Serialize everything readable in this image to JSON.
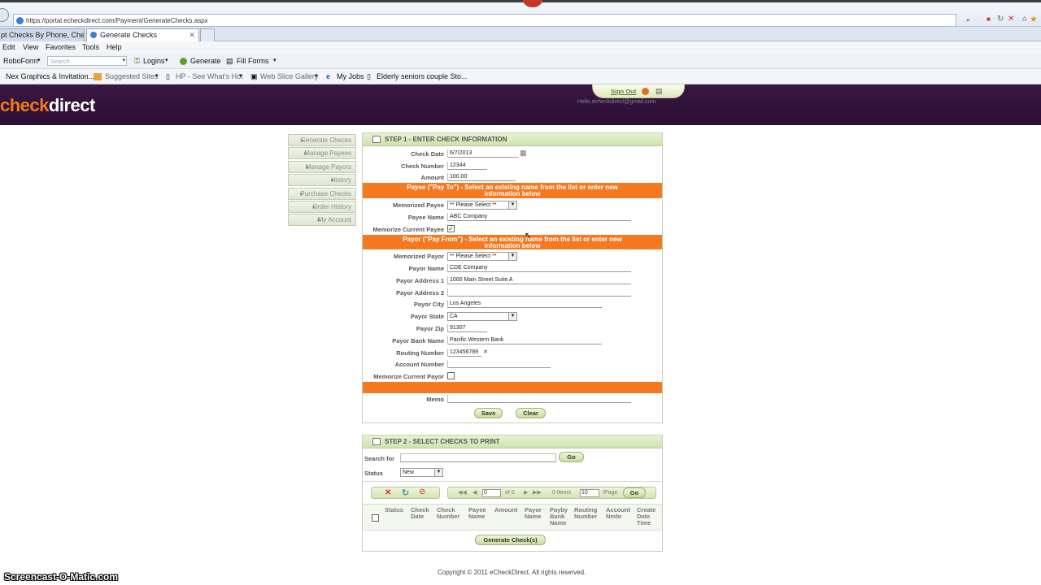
{
  "browser": {
    "url": "https://portal.echeckdirect.com/Payment/GenerateChecks.aspx",
    "tabs": [
      {
        "label": "pt Checks By Phone, Che..."
      },
      {
        "label": "Generate Checks"
      }
    ],
    "menu": [
      "Edit",
      "View",
      "Favorites",
      "Tools",
      "Help"
    ],
    "roboform": {
      "label": "RoboForm",
      "search_placeholder": "Search",
      "logins": "Logins",
      "generate": "Generate",
      "fill_forms": "Fill Forms"
    },
    "favorites": [
      "Nex Graphics & Invitation...",
      "Suggested Sites",
      "HP - See What's Hot",
      "Web Slice Gallery",
      "My Jobs",
      "Elderly seniors couple Sto..."
    ]
  },
  "header": {
    "logo_part1": "check",
    "logo_part2": "direct",
    "sign_out": "Sign Out",
    "hello": "Hello echeckdirect@gmail.com"
  },
  "nav": [
    "Generate Checks",
    "Manage Payees",
    "Manage Payors",
    "History",
    "Purchase Checks",
    "Order History",
    "My Account"
  ],
  "step1": {
    "title": "STEP 1 - ENTER CHECK INFORMATION",
    "check_date": {
      "label": "Check Date",
      "value": "6/7/2013"
    },
    "check_number": {
      "label": "Check Number",
      "value": "12344"
    },
    "amount": {
      "label": "Amount",
      "value": "100.00"
    },
    "payee_banner_line1": "Payee (\"Pay To\") - Select an existing name from the list or enter new",
    "payee_banner_line2": "information below",
    "memorized_payee": {
      "label": "Memorized Payee",
      "value": "** Please Select **"
    },
    "payee_name": {
      "label": "Payee Name",
      "value": "ABC Company"
    },
    "memorize_payee": {
      "label": "Memorize Current Payee",
      "checked": true
    },
    "payor_banner_line1": "Payor (\"Pay From\") - Select an existing name from the list or enter new",
    "payor_banner_line2": "information below",
    "memorized_payor": {
      "label": "Memorized Payor",
      "value": "** Please Select **"
    },
    "payor_name": {
      "label": "Payor Name",
      "value": "CDE Company"
    },
    "payor_address1": {
      "label": "Payor Address 1",
      "value": "1000 Main Street Suite A"
    },
    "payor_address2": {
      "label": "Payor Address 2",
      "value": ""
    },
    "payor_city": {
      "label": "Payor City",
      "value": "Los Angeles"
    },
    "payor_state": {
      "label": "Payor State",
      "value": "CA"
    },
    "payor_zip": {
      "label": "Payor Zip",
      "value": "91307"
    },
    "payor_bank": {
      "label": "Payor Bank Name",
      "value": "Pacific Western Bank"
    },
    "routing": {
      "label": "Routing Number",
      "value": "123456789"
    },
    "account": {
      "label": "Account Number",
      "value": ""
    },
    "memorize_payor": {
      "label": "Memorize Current Payor",
      "checked": false
    },
    "memo": {
      "label": "Memo",
      "value": ""
    },
    "save": "Save",
    "clear": "Clear"
  },
  "step2": {
    "title": "STEP 2 - SELECT CHECKS TO PRINT",
    "search_label": "Search for",
    "search_value": "",
    "go": "Go",
    "status_label": "Status",
    "status_value": "New",
    "pager": {
      "page": "0",
      "of": "of 0",
      "items": "0 Items",
      "per_page": "10",
      "per_page_label": "/Page",
      "go": "Go"
    },
    "columns": [
      "Status",
      "Check Date",
      "Check Number",
      "Payee Name",
      "Amount",
      "Payor Name",
      "Payby Bank Name",
      "Routing Number",
      "Account Nmbr",
      "Create Date Time"
    ],
    "generate": "Generate Check(s)"
  },
  "footer": {
    "copyright": "Copyright © 2011 eCheckDirect. All rights reserved."
  },
  "watermark": "Screencast-O-Matic.com"
}
